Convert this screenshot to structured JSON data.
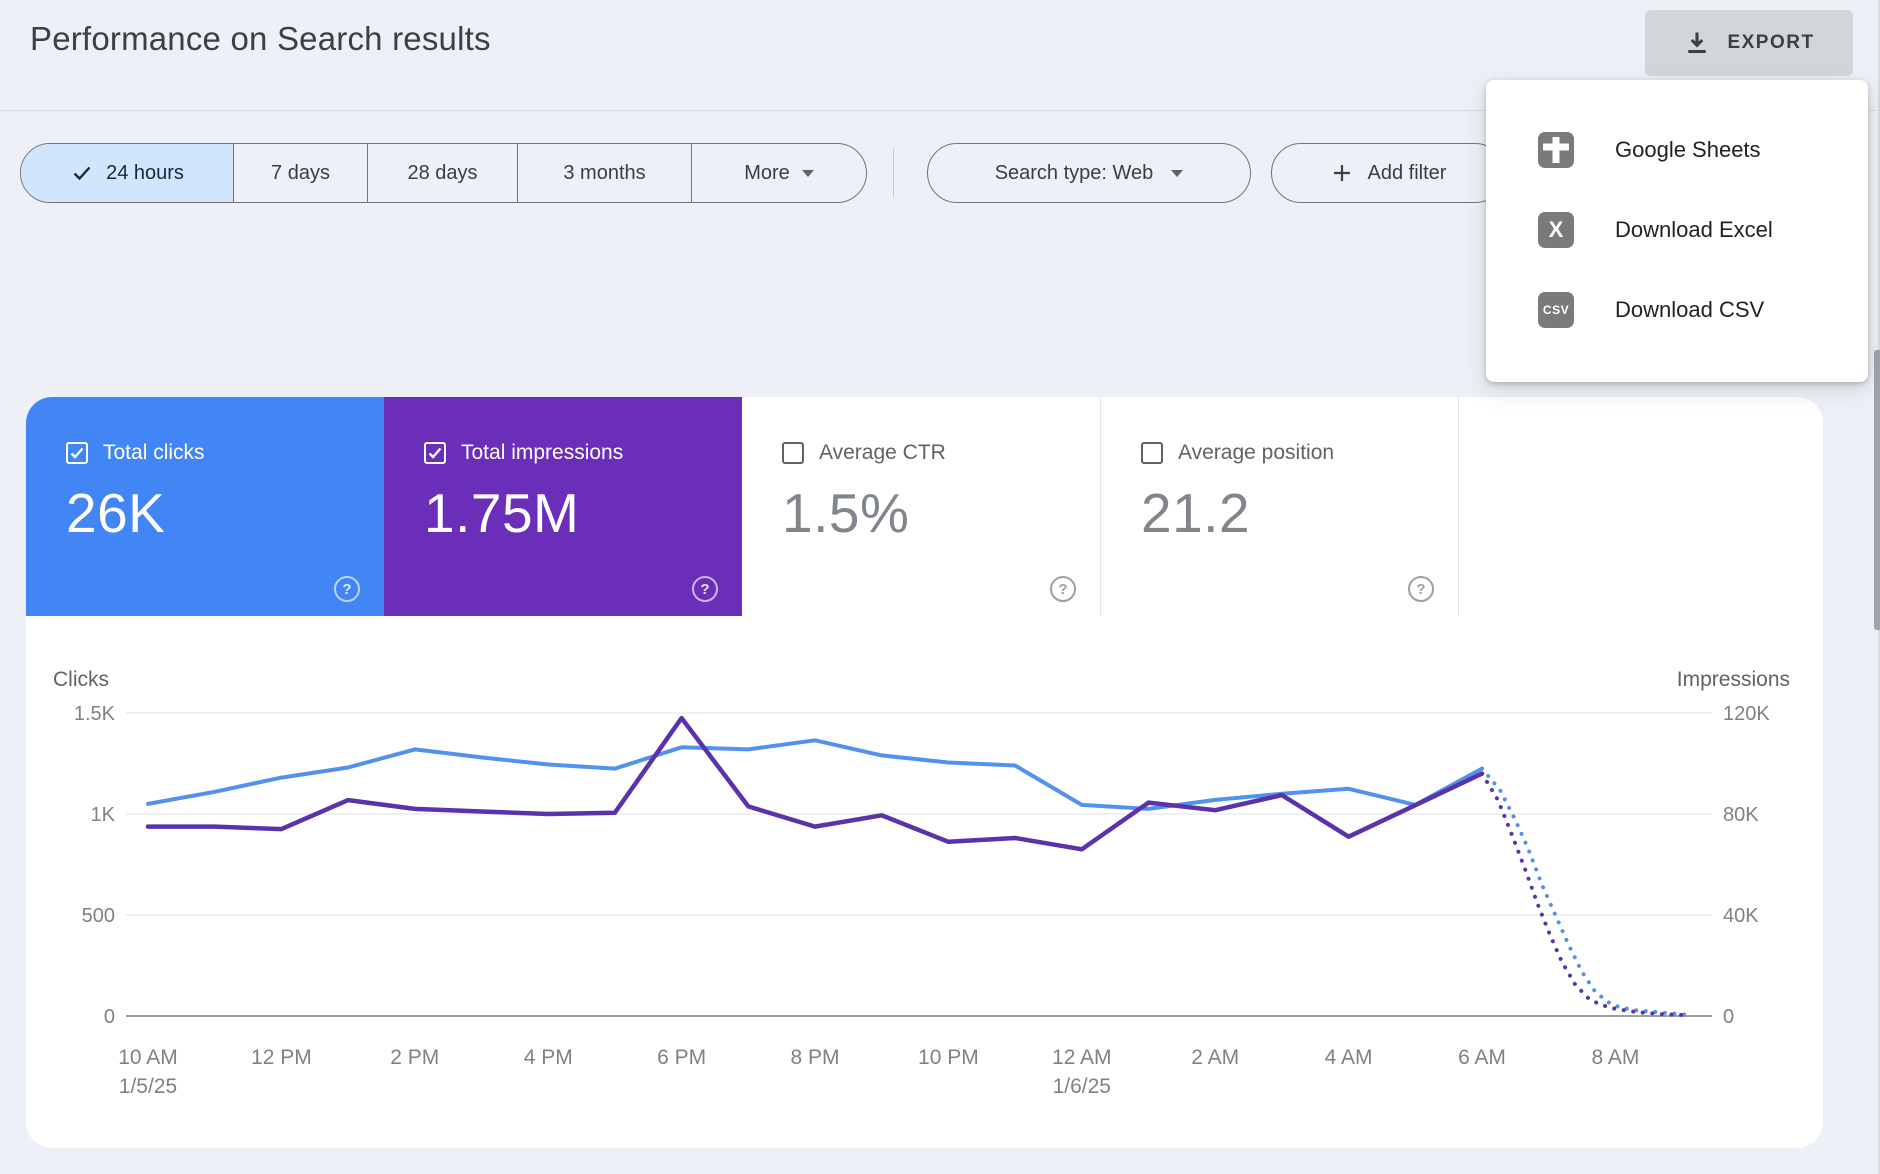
{
  "header": {
    "title": "Performance on Search results"
  },
  "toolbar": {
    "export_label": "EXPORT"
  },
  "export_menu": {
    "items": [
      {
        "icon": "google-sheets",
        "label": "Google Sheets"
      },
      {
        "icon": "excel",
        "label": "Download Excel"
      },
      {
        "icon": "csv",
        "label": "Download CSV"
      }
    ]
  },
  "filters": {
    "date_ranges": [
      "24 hours",
      "7 days",
      "28 days",
      "3 months"
    ],
    "selected_range": "24 hours",
    "more_label": "More",
    "search_type": "Search type: Web",
    "add_filter": "Add filter"
  },
  "metrics": [
    {
      "label": "Total clicks",
      "value": "26K",
      "selected": true,
      "color": "#4285f4"
    },
    {
      "label": "Total impressions",
      "value": "1.75M",
      "selected": true,
      "color": "#6b2eb8"
    },
    {
      "label": "Average CTR",
      "value": "1.5%",
      "selected": false,
      "color": "#ffffff"
    },
    {
      "label": "Average position",
      "value": "21.2",
      "selected": false,
      "color": "#ffffff"
    }
  ],
  "chart_data": {
    "type": "line",
    "title": "Clicks and impressions by hour",
    "categories_hours": [
      "10 AM",
      "11 AM",
      "12 PM",
      "1 PM",
      "2 PM",
      "3 PM",
      "4 PM",
      "5 PM",
      "6 PM",
      "7 PM",
      "8 PM",
      "9 PM",
      "10 PM",
      "11 PM",
      "12 AM",
      "1 AM",
      "2 AM",
      "3 AM",
      "4 AM",
      "5 AM",
      "6 AM"
    ],
    "series": [
      {
        "name": "Total clicks",
        "axis": "left",
        "color": "#5392ec",
        "values": [
          1050,
          1110,
          1180,
          1230,
          1320,
          1280,
          1245,
          1225,
          1330,
          1320,
          1365,
          1290,
          1255,
          1240,
          1045,
          1025,
          1070,
          1100,
          1125,
          1045,
          1225
        ]
      },
      {
        "name": "Total impressions",
        "axis": "right",
        "color": "#5a32ac",
        "values": [
          75000,
          75000,
          74000,
          85500,
          82000,
          81000,
          80000,
          80500,
          118000,
          83000,
          75000,
          79500,
          69000,
          70500,
          66000,
          84500,
          81500,
          87500,
          71000,
          83500,
          96000
        ]
      }
    ],
    "projection_dotted": {
      "description": "dotted incomplete-data tail after 6 AM, hours offset from 10 AM",
      "clicks_points": [
        [
          20,
          1225
        ],
        [
          20.27,
          1119
        ],
        [
          20.5,
          970
        ],
        [
          20.7,
          822
        ],
        [
          20.9,
          649
        ],
        [
          21.1,
          500
        ],
        [
          21.3,
          351
        ],
        [
          21.5,
          218
        ],
        [
          21.7,
          119
        ],
        [
          21.95,
          54
        ],
        [
          22.25,
          30
        ],
        [
          22.6,
          20
        ],
        [
          22.94,
          10
        ],
        [
          23.12,
          5
        ]
      ],
      "impressions_points": [
        [
          20,
          96000
        ],
        [
          20.24,
          85500
        ],
        [
          20.45,
          71700
        ],
        [
          20.65,
          57800
        ],
        [
          20.84,
          44000
        ],
        [
          21.02,
          32100
        ],
        [
          21.2,
          21400
        ],
        [
          21.4,
          12300
        ],
        [
          21.62,
          6300
        ],
        [
          21.92,
          3200
        ],
        [
          22.3,
          1600
        ],
        [
          22.67,
          800
        ],
        [
          23.02,
          400
        ]
      ]
    },
    "left_axis": {
      "title": "Clicks",
      "max": 1500,
      "ticks": [
        {
          "label": "0",
          "value": 0
        },
        {
          "label": "500",
          "value": 500
        },
        {
          "label": "1K",
          "value": 1000
        },
        {
          "label": "1.5K",
          "value": 1500
        }
      ]
    },
    "right_axis": {
      "title": "Impressions",
      "max": 120000,
      "ticks": [
        {
          "label": "0",
          "value": 0
        },
        {
          "label": "40K",
          "value": 40000
        },
        {
          "label": "80K",
          "value": 80000
        },
        {
          "label": "120K",
          "value": 120000
        }
      ]
    },
    "x_axis": {
      "hours_per_tick": 2,
      "ticks": [
        {
          "label": "10 AM",
          "sub": "1/5/25"
        },
        {
          "label": "12 PM"
        },
        {
          "label": "2 PM"
        },
        {
          "label": "4 PM"
        },
        {
          "label": "6 PM"
        },
        {
          "label": "8 PM"
        },
        {
          "label": "10 PM"
        },
        {
          "label": "12 AM",
          "sub": "1/6/25"
        },
        {
          "label": "2 AM"
        },
        {
          "label": "4 AM"
        },
        {
          "label": "6 AM"
        },
        {
          "label": "8 AM"
        }
      ]
    },
    "grid": true,
    "legend": "none",
    "colors": {
      "grid": "#e9ebee",
      "zero_line": "#9aa0a6",
      "tick_text": "#7d8287",
      "axis_title": "#5f6368"
    }
  }
}
